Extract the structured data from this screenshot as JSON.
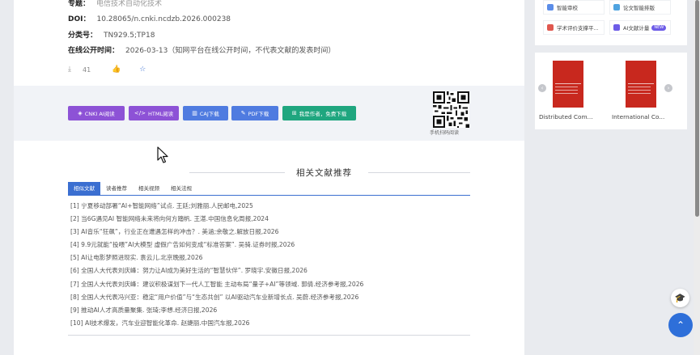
{
  "article": {
    "special_label": "专题：",
    "special_value": "电信技术自动化技术",
    "doi_label": "DOI：",
    "doi_value": "10.28065/n.cnki.ncdzb.2026.000238",
    "class_label": "分类号：",
    "class_value": "TN929.5;TP18",
    "pub_label": "在线公开时间：",
    "pub_value": "2026-03-13（知网平台在线公开时间，不代表文献的发表时间）",
    "download_count": "41"
  },
  "actions": {
    "cnki_ai": "CNKI AI阅读",
    "html_read": "HTML阅读",
    "caj_download": "CAJ下载",
    "pdf_download": "PDF下载",
    "free_download": "我是作者，免费下载",
    "qr_label": "手机扫码阅读"
  },
  "related": {
    "title": "相关文献推荐",
    "tabs": [
      "相似文献",
      "读者推荐",
      "相关视频",
      "相关法规"
    ],
    "active_tab": "相似文献",
    "items": [
      "[1] 宁夏移动部署“AI+智能网络”试点. 王廷;刘雅丽.人民邮电,2025",
      "[2] 当6G遇见AI 智能网络未来将向何方踏帆. 王湛.中国信息化周报,2024",
      "[3] AI音乐“狂飙”，行业正在遭遇怎样的冲击？. 美涵;余敬之.解放日报,2026",
      "[4] 9.9元就能“投喂”AI大模型 虚假广告如何变成“标准答案”. 吴骑.证券时报,2026",
      "[5] AI让电影梦照进现实. 袁云儿.北京晚报,2026",
      "[6] 全国人大代表刘庆峰：努力让AI成为美好生活的“智慧伙伴”. 罗晓宇.安徽日报,2026",
      "[7] 全国人大代表刘庆峰：建议积极谋划下一代人工智能 主动布局“量子+AI”等领域. 郭倩.经济参考报,2026",
      "[8] 全国人大代表冯兴亚：稳定“用户价值”与“生态共创” 以AI驱动汽车业新增长点. 吴蔚.经济参考报,2026",
      "[9] 推动AI人才高质量聚集. 张琦;李想.经济日报,2026",
      "[10] AI技术爆发，汽车业迎智能化革命. 赵婕丽.中国汽车报,2026"
    ]
  },
  "sidebar": {
    "tools": [
      {
        "label": "智能审校",
        "color": "#5b8de8"
      },
      {
        "label": "论文智能排版",
        "color": "#4fa3e0"
      },
      {
        "label": "学术评价支撑平...",
        "color": "#e0584f"
      },
      {
        "label": "AI文献计量",
        "color": "#6d5ce7"
      }
    ],
    "new_badge": "NEW",
    "books": [
      {
        "title": "Distributed Com..."
      },
      {
        "title": "International Co..."
      }
    ]
  }
}
